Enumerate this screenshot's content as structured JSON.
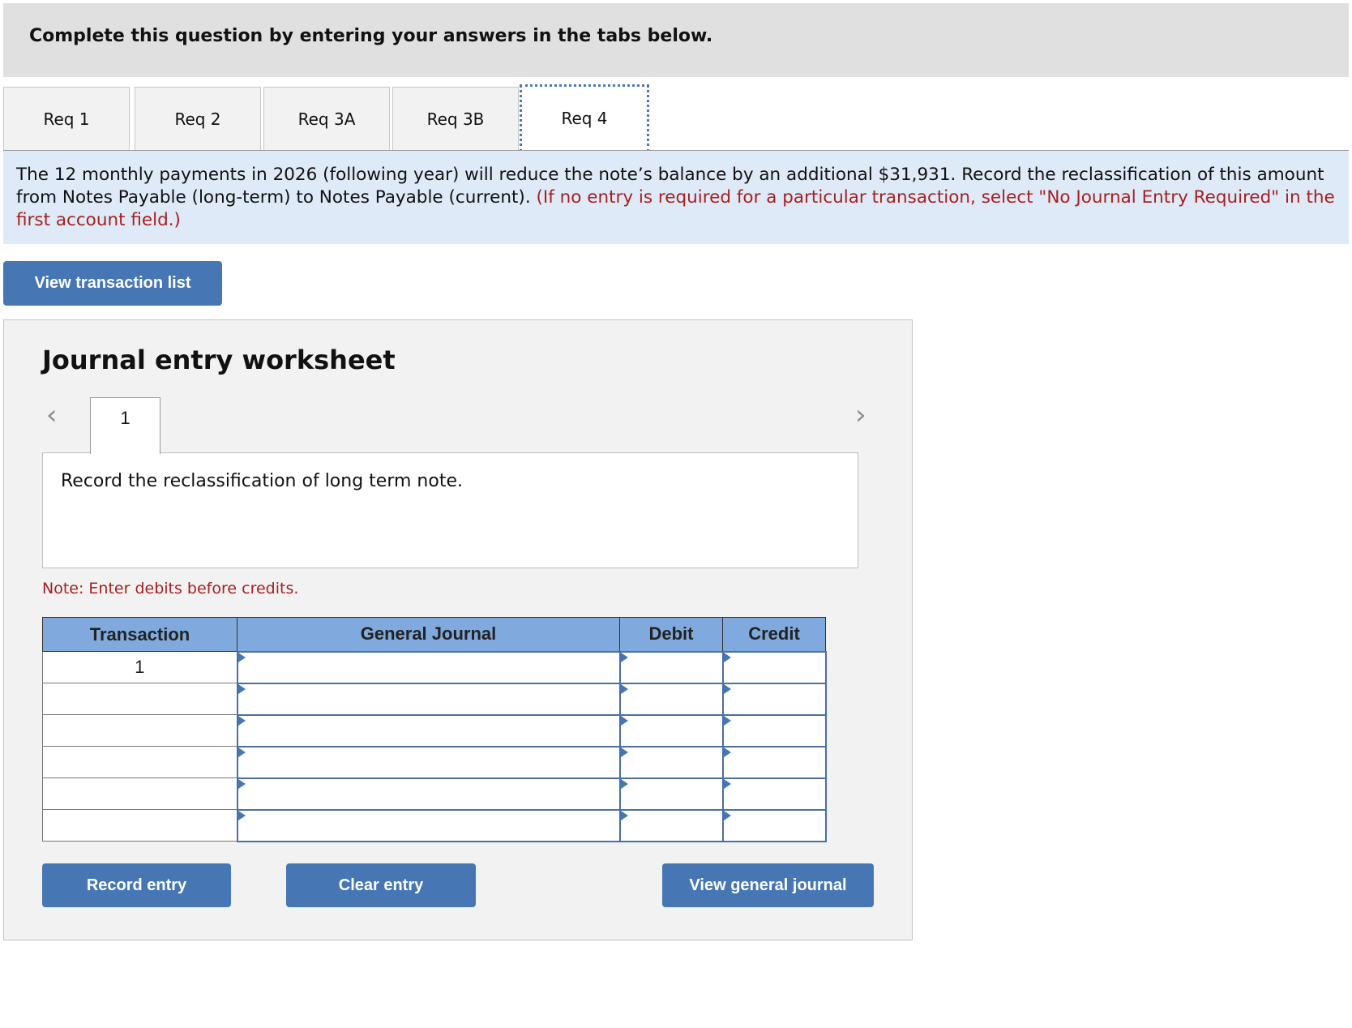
{
  "header": {
    "title": "Complete this question by entering your answers in the tabs below."
  },
  "tabs": [
    {
      "label": "Req 1",
      "active": false
    },
    {
      "label": "Req 2",
      "active": false
    },
    {
      "label": "Req 3A",
      "active": false
    },
    {
      "label": "Req 3B",
      "active": false
    },
    {
      "label": "Req 4",
      "active": true
    }
  ],
  "instructions": {
    "text": "The 12 monthly payments in 2026 (following year) will reduce the note’s balance by an additional $31,931. Record the reclassification of this amount from Notes Payable (long-term) to Notes Payable (current). ",
    "note_red": "(If no entry is required for a particular transaction, select \"No Journal Entry Required\" in the first account field.)"
  },
  "view_transaction_list_label": "View transaction list",
  "worksheet": {
    "title": "Journal entry worksheet",
    "prev_icon": "chevron-left-icon",
    "next_icon": "chevron-right-icon",
    "entry_tab": "1",
    "description": "Record the reclassification of long term note.",
    "note": "Note: Enter debits before credits.",
    "table": {
      "headers": [
        "Transaction",
        "General Journal",
        "Debit",
        "Credit"
      ],
      "rows": [
        {
          "transaction": "1",
          "account": "",
          "debit": "",
          "credit": ""
        },
        {
          "transaction": "",
          "account": "",
          "debit": "",
          "credit": ""
        },
        {
          "transaction": "",
          "account": "",
          "debit": "",
          "credit": ""
        },
        {
          "transaction": "",
          "account": "",
          "debit": "",
          "credit": ""
        },
        {
          "transaction": "",
          "account": "",
          "debit": "",
          "credit": ""
        },
        {
          "transaction": "",
          "account": "",
          "debit": "",
          "credit": ""
        }
      ]
    },
    "buttons": {
      "record": "Record entry",
      "clear": "Clear entry",
      "view_general_journal": "View general journal"
    }
  },
  "colors": {
    "accent_button": "#4677b4",
    "table_header": "#80aade",
    "instruction_bg": "#deeaf7",
    "note_red": "#a7201f"
  }
}
